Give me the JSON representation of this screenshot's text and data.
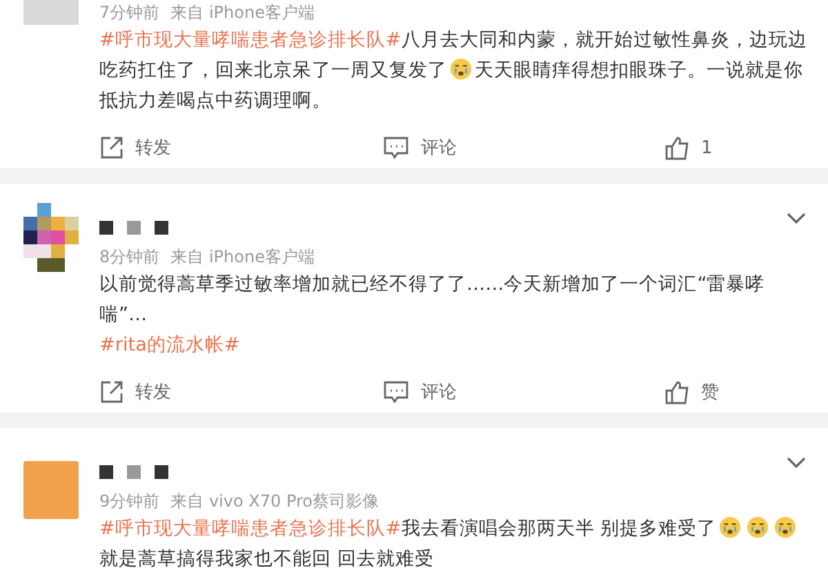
{
  "posts": [
    {
      "avatar": {
        "kind": "cut"
      },
      "name_redacted": false,
      "menu": false,
      "meta": {
        "time": "7分钟前",
        "source": "来自 iPhone客户端"
      },
      "body": [
        {
          "kind": "tag",
          "text": "#呼市现大量哮喘患者急诊排长队#"
        },
        {
          "kind": "text",
          "text": "八月去大同和内蒙，就开始过敏性鼻炎，边玩边吃药扛住了，回来北京呆了一周又复发了"
        },
        {
          "kind": "emoji"
        },
        {
          "kind": "text",
          "text": "天天眼睛痒得想扣眼珠子。一说就是你抵抗力差喝点中药调理啊。"
        }
      ],
      "actions": [
        {
          "kind": "repost",
          "label": "转发"
        },
        {
          "kind": "comment",
          "label": "评论"
        },
        {
          "kind": "like",
          "label": "1"
        }
      ]
    },
    {
      "avatar": {
        "kind": "mosaic"
      },
      "name_redacted": true,
      "menu": true,
      "meta": {
        "time": "8分钟前",
        "source": "来自 iPhone客户端"
      },
      "body": [
        {
          "kind": "text",
          "text": "以前觉得蒿草季过敏率增加就已经不得了了……今天新增加了一个词汇“雷暴哮喘”…"
        }
      ],
      "tags": [
        "#rita的流水帐#"
      ],
      "actions": [
        {
          "kind": "repost",
          "label": "转发"
        },
        {
          "kind": "comment",
          "label": "评论"
        },
        {
          "kind": "like",
          "label": "赞"
        }
      ]
    },
    {
      "avatar": {
        "kind": "plain"
      },
      "name_redacted": true,
      "menu": true,
      "meta": {
        "time": "9分钟前",
        "source": "来自 vivo X70 Pro蔡司影像"
      },
      "body": [
        {
          "kind": "tag",
          "text": "#呼市现大量哮喘患者急诊排长队#"
        },
        {
          "kind": "text",
          "text": "我去看演唱会那两天半 别提多难受了"
        },
        {
          "kind": "emoji"
        },
        {
          "kind": "emoji"
        },
        {
          "kind": "emoji"
        },
        {
          "kind": "text",
          "text": "就是蒿草搞得我家也不能回 回去就难受"
        }
      ]
    }
  ]
}
